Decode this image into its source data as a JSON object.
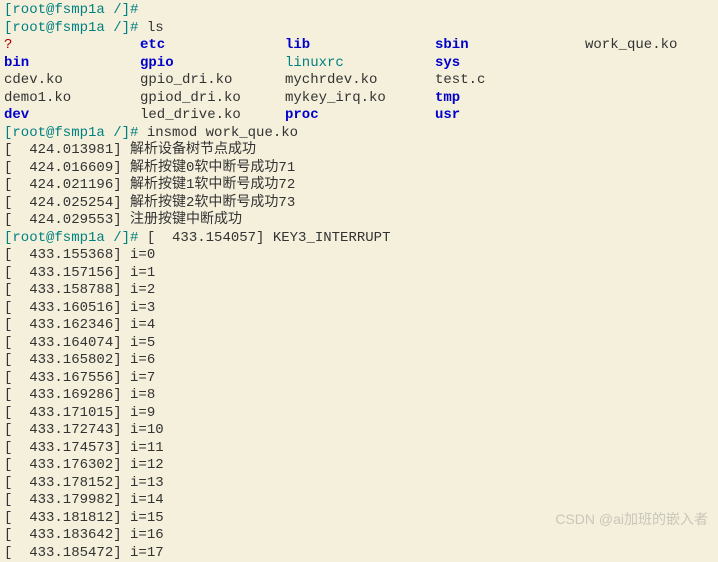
{
  "prompts": {
    "p0": "[root@fsmp1a /]#",
    "p1": "[root@fsmp1a /]# ",
    "p2": "[root@fsmp1a /]# ",
    "p3": "[root@fsmp1a /]# "
  },
  "commands": {
    "ls": "ls",
    "insmod": "insmod work_que.ko"
  },
  "ls": {
    "r0": {
      "c0": "?",
      "c1": "etc",
      "c2": "lib",
      "c3": "sbin",
      "c4": "work_que.ko"
    },
    "r1": {
      "c0": "bin",
      "c1": "gpio",
      "c2": "linuxrc",
      "c3": "sys",
      "c4": ""
    },
    "r2": {
      "c0": "cdev.ko",
      "c1": "gpio_dri.ko",
      "c2": "mychrdev.ko",
      "c3": "test.c",
      "c4": ""
    },
    "r3": {
      "c0": "demo1.ko",
      "c1": "gpiod_dri.ko",
      "c2": "mykey_irq.ko",
      "c3": "tmp",
      "c4": ""
    },
    "r4": {
      "c0": "dev",
      "c1": "led_drive.ko",
      "c2": "proc",
      "c3": "usr",
      "c4": ""
    }
  },
  "kmsg": {
    "m0": "[  424.013981] 解析设备树节点成功",
    "m1": "[  424.016609] 解析按键0软中断号成功71",
    "m2": "[  424.021196] 解析按键1软中断号成功72",
    "m3": "[  424.025254] 解析按键2软中断号成功73",
    "m4": "[  424.029553] 注册按键中断成功"
  },
  "intr": {
    "hdr": "[  433.154057] KEY3_INTERRUPT",
    "l0": "[  433.155368] i=0",
    "l1": "[  433.157156] i=1",
    "l2": "[  433.158788] i=2",
    "l3": "[  433.160516] i=3",
    "l4": "[  433.162346] i=4",
    "l5": "[  433.164074] i=5",
    "l6": "[  433.165802] i=6",
    "l7": "[  433.167556] i=7",
    "l8": "[  433.169286] i=8",
    "l9": "[  433.171015] i=9",
    "l10": "[  433.172743] i=10",
    "l11": "[  433.174573] i=11",
    "l12": "[  433.176302] i=12",
    "l13": "[  433.178152] i=13",
    "l14": "[  433.179982] i=14",
    "l15": "[  433.181812] i=15",
    "l16": "[  433.183642] i=16",
    "l17": "[  433.185472] i=17"
  },
  "watermark": "CSDN @ai加班的嵌入者"
}
